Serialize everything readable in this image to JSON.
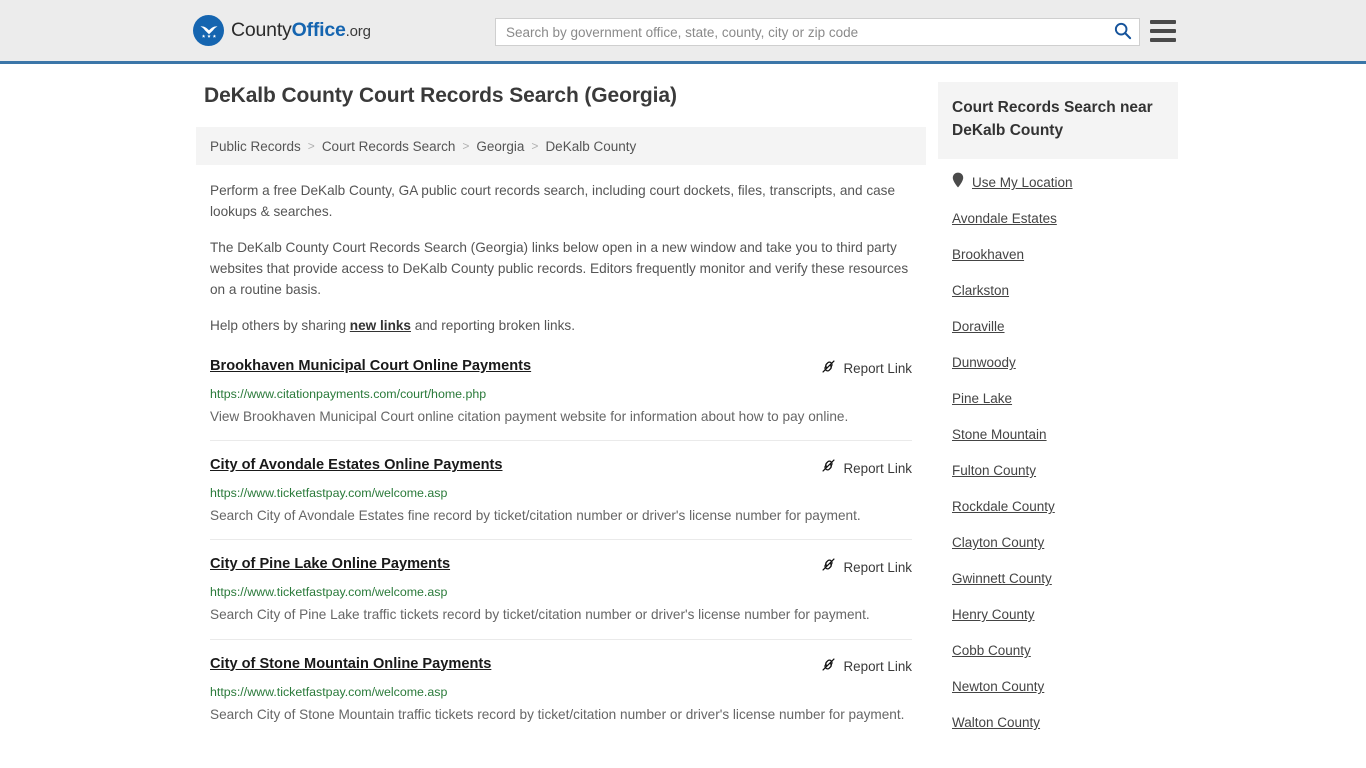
{
  "header": {
    "logo": {
      "icon": "eagle-shield-logo-icon",
      "text_county": "County",
      "text_office": "Office",
      "text_org": ".org"
    },
    "search": {
      "placeholder": "Search by government office, state, county, city or zip code",
      "value": "",
      "icon": "search-icon"
    },
    "menu_icon": "hamburger-menu-icon",
    "accent_color": "#3b76a8",
    "background_color": "#ececec"
  },
  "page_title": "DeKalb County Court Records Search (Georgia)",
  "breadcrumb": {
    "separator": ">",
    "items": [
      {
        "label": "Public Records"
      },
      {
        "label": "Court Records Search"
      },
      {
        "label": "Georgia"
      },
      {
        "label": "DeKalb County"
      }
    ]
  },
  "intro": {
    "paragraph_1": "Perform a free DeKalb County, GA public court records search, including court dockets, files, transcripts, and case lookups & searches.",
    "paragraph_2": "The DeKalb County Court Records Search (Georgia) links below open in a new window and take you to third party websites that provide access to DeKalb County public records. Editors frequently monitor and verify these resources on a routine basis.",
    "paragraph_3_before": "Help others by sharing ",
    "paragraph_3_link": "new links",
    "paragraph_3_after": " and reporting broken links."
  },
  "report_link": {
    "label": "Report Link",
    "icon": "broken-link-icon"
  },
  "results": [
    {
      "title": "Brookhaven Municipal Court Online Payments",
      "url": "https://www.citationpayments.com/court/home.php",
      "description": "View Brookhaven Municipal Court online citation payment website for information about how to pay online."
    },
    {
      "title": "City of Avondale Estates Online Payments",
      "url": "https://www.ticketfastpay.com/welcome.asp",
      "description": "Search City of Avondale Estates fine record by ticket/citation number or driver's license number for payment."
    },
    {
      "title": "City of Pine Lake Online Payments",
      "url": "https://www.ticketfastpay.com/welcome.asp",
      "description": "Search City of Pine Lake traffic tickets record by ticket/citation number or driver's license number for payment."
    },
    {
      "title": "City of Stone Mountain Online Payments",
      "url": "https://www.ticketfastpay.com/welcome.asp",
      "description": "Search City of Stone Mountain traffic tickets record by ticket/citation number or driver's license number for payment."
    }
  ],
  "sidebar": {
    "heading": "Court Records Search near DeKalb County",
    "use_my_location": {
      "label": "Use My Location",
      "icon": "map-pin-icon"
    },
    "items": [
      {
        "label": "Avondale Estates"
      },
      {
        "label": "Brookhaven"
      },
      {
        "label": "Clarkston"
      },
      {
        "label": "Doraville"
      },
      {
        "label": "Dunwoody"
      },
      {
        "label": "Pine Lake"
      },
      {
        "label": "Stone Mountain"
      },
      {
        "label": "Fulton County"
      },
      {
        "label": "Rockdale County"
      },
      {
        "label": "Clayton County"
      },
      {
        "label": "Gwinnett County"
      },
      {
        "label": "Henry County"
      },
      {
        "label": "Cobb County"
      },
      {
        "label": "Newton County"
      },
      {
        "label": "Walton County"
      }
    ]
  },
  "colors": {
    "link_green": "#2a7a3a",
    "brand_blue": "#1565b0",
    "header_rule": "#3b76a8"
  }
}
